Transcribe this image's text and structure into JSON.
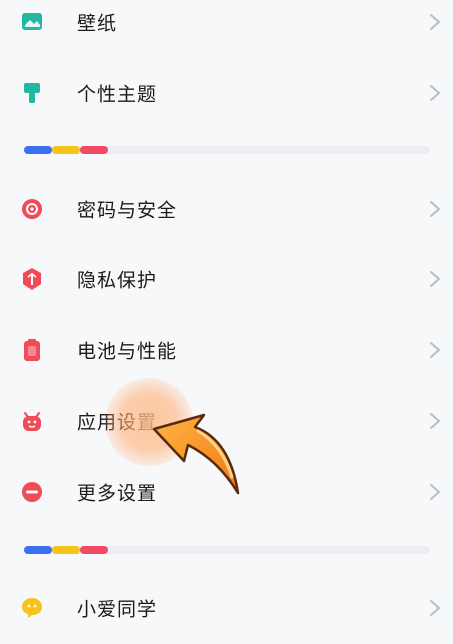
{
  "menu": {
    "items": [
      {
        "label": "壁纸",
        "icon": "wallpaper-icon",
        "color": "#25b8a0"
      },
      {
        "label": "个性主题",
        "icon": "theme-brush-icon",
        "color": "#22b7a1"
      },
      {
        "label": "密码与安全",
        "icon": "security-lock-icon",
        "color": "#f04b56"
      },
      {
        "label": "隐私保护",
        "icon": "privacy-shield-icon",
        "color": "#f04b56"
      },
      {
        "label": "电池与性能",
        "icon": "battery-icon",
        "color": "#f04b56"
      },
      {
        "label": "应用设置",
        "icon": "app-android-icon",
        "color": "#f04b56"
      },
      {
        "label": "更多设置",
        "icon": "more-settings-icon",
        "color": "#f04b56"
      },
      {
        "label": "小爱同学",
        "icon": "xiaoai-assistant-icon",
        "color": "#f7c21b"
      }
    ]
  },
  "divider_colors": [
    "#3b6ff0",
    "#f6c21c",
    "#f04b62"
  ],
  "chevron_color": "#b8bcc4"
}
